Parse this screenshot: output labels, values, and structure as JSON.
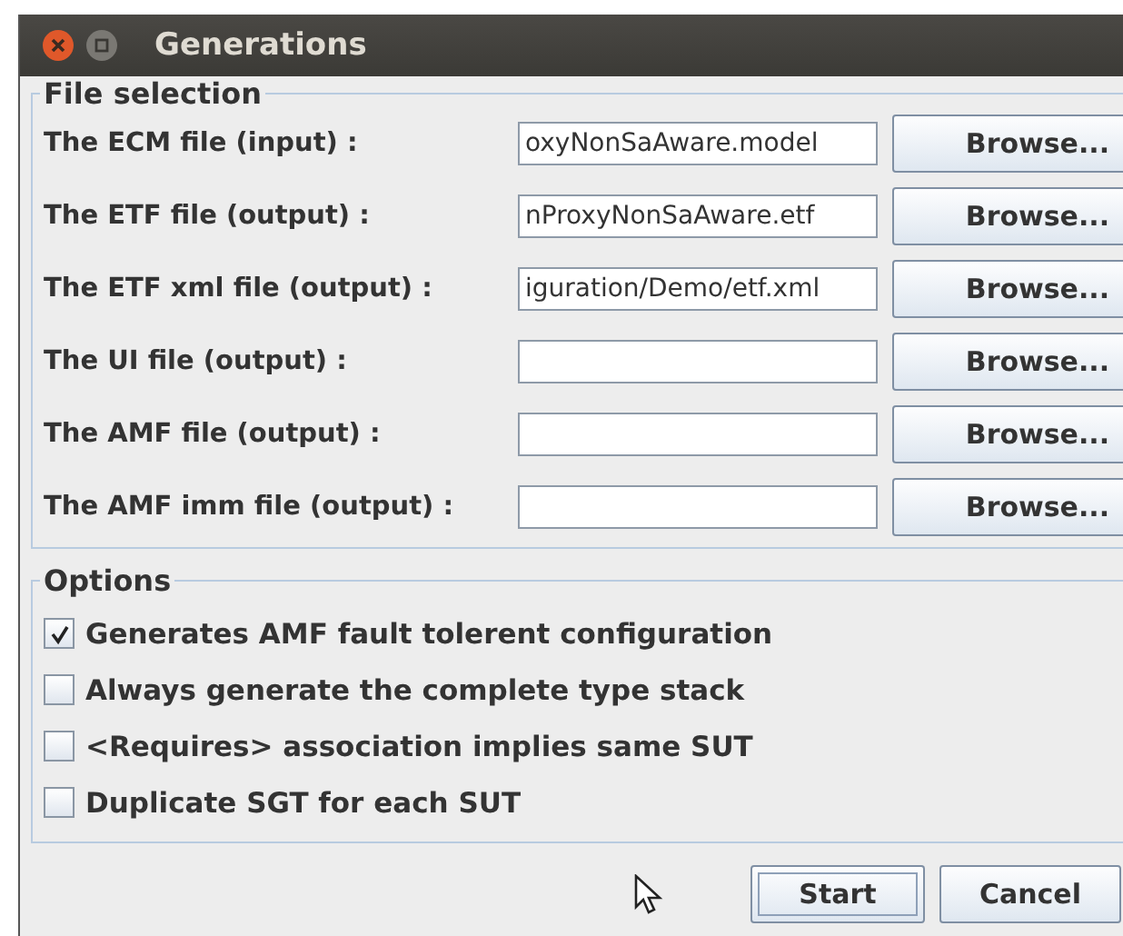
{
  "window": {
    "title": "Generations"
  },
  "file_selection": {
    "title": "File selection",
    "rows": [
      {
        "label": "The ECM file (input) :",
        "value": "oxyNonSaAware.model",
        "button": "Browse..."
      },
      {
        "label": "The ETF file (output) :",
        "value": "nProxyNonSaAware.etf",
        "button": "Browse..."
      },
      {
        "label": "The ETF xml file (output) :",
        "value": "iguration/Demo/etf.xml",
        "button": "Browse..."
      },
      {
        "label": "The UI file (output) :",
        "button": "Browse..."
      },
      {
        "label": "The AMF file (output) :",
        "button": "Browse..."
      },
      {
        "label": "The AMF imm file (output) :",
        "button": "Browse..."
      }
    ]
  },
  "options": {
    "title": "Options",
    "items": [
      {
        "label": "Generates AMF fault tolerent configuration",
        "checked": true
      },
      {
        "label": "Always generate the complete type stack",
        "checked": false
      },
      {
        "label": "<Requires> association implies same SUT",
        "checked": false
      },
      {
        "label": "Duplicate SGT for each SUT",
        "checked": false
      }
    ]
  },
  "buttons": [
    {
      "label": "Start",
      "focused": true
    },
    {
      "label": "Cancel",
      "focused": false
    }
  ]
}
